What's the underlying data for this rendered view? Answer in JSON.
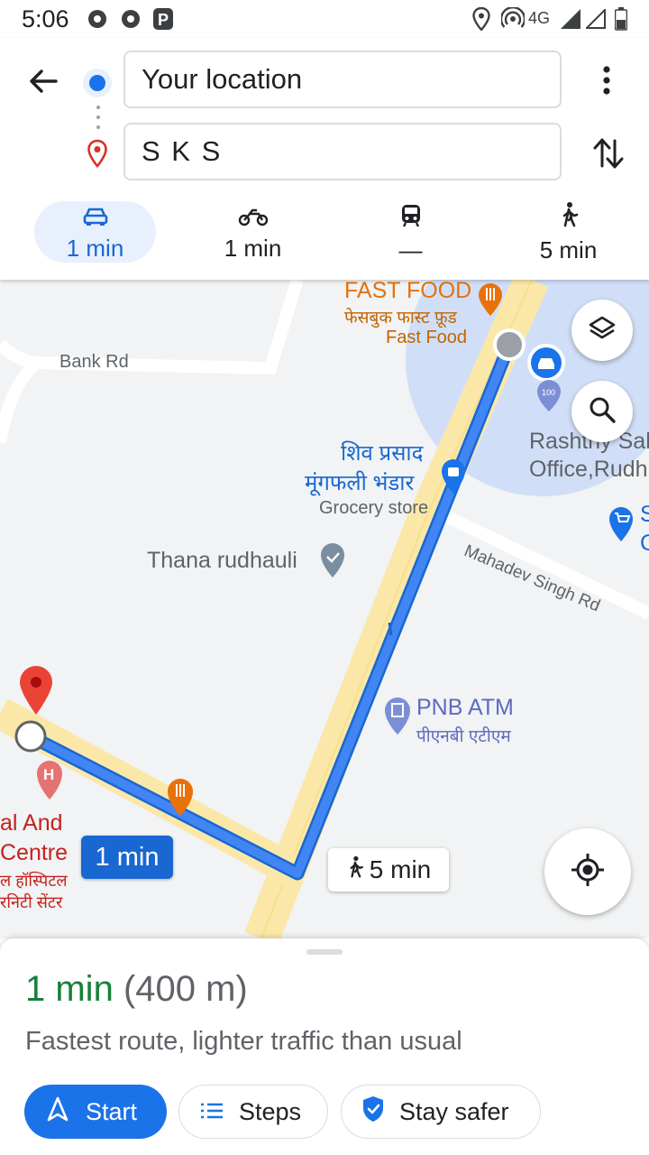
{
  "status_bar": {
    "time": "5:06",
    "network": "4G"
  },
  "directions": {
    "origin": "Your location",
    "destination": "S K S"
  },
  "modes": [
    {
      "name": "drive",
      "label": "1 min",
      "selected": true
    },
    {
      "name": "motorbike",
      "label": "1 min",
      "selected": false
    },
    {
      "name": "transit",
      "label": "—",
      "selected": false
    },
    {
      "name": "walk",
      "label": "5 min",
      "selected": false
    }
  ],
  "map": {
    "labels": {
      "fast_food_en": "FAST FOOD",
      "fast_food_hi": "फेसबुक फास्ट फ़ूड",
      "fast_food_cat": "Fast Food",
      "bank_rd": "Bank Rd",
      "rashtriya": "Rashtriy Sah",
      "office": "Office,Rudh",
      "shiv_1": "शिव प्रसाद",
      "shiv_2": "मूंगफली भंडार",
      "grocery": "Grocery store",
      "mahadev": "Mahadev Singh Rd",
      "thana": "Thana rudhauli",
      "pnb_en": "PNB ATM",
      "pnb_hi": "पीएनबी एटीएम",
      "hosp_1": "al And",
      "hosp_2": "Centre",
      "hosp_3": "ल हॉस्पिटल",
      "hosp_4": "रनिटी सेंटर",
      "edge_s": "S",
      "edge_c": "C"
    },
    "drive_callout": "1 min",
    "walk_callout": "5 min"
  },
  "route": {
    "duration": "1 min",
    "distance": "(400 m)",
    "summary": "Fastest route, lighter traffic than usual"
  },
  "actions": {
    "start": "Start",
    "steps": "Steps",
    "stay_safer": "Stay safer"
  },
  "colors": {
    "accent": "#1a73e8",
    "route_green": "#188038",
    "destination_red": "#ea4335",
    "route_line": "#4285f4"
  }
}
